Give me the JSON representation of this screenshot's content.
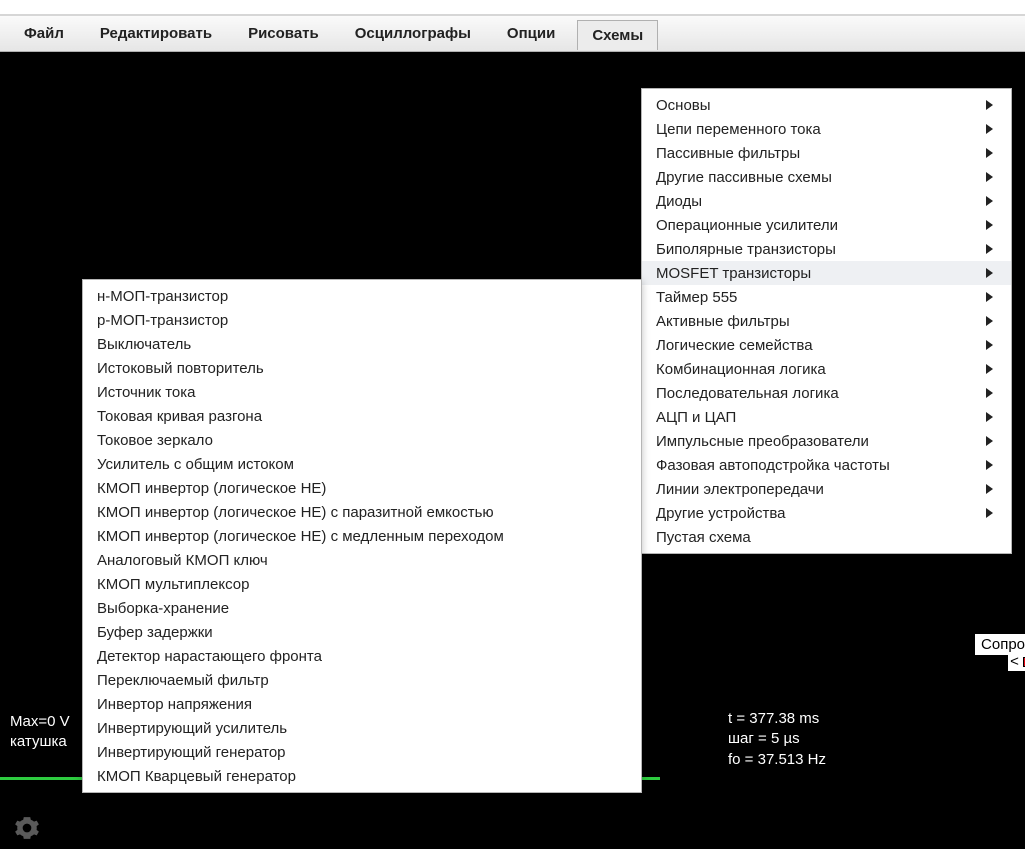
{
  "menubar": {
    "items": [
      {
        "label": "Файл"
      },
      {
        "label": "Редактировать"
      },
      {
        "label": "Рисовать"
      },
      {
        "label": "Осциллографы"
      },
      {
        "label": "Опции"
      },
      {
        "label": "Схемы",
        "active": true
      }
    ]
  },
  "main_menu": {
    "items": [
      {
        "label": "Основы",
        "submenu": true
      },
      {
        "label": "Цепи переменного тока",
        "submenu": true
      },
      {
        "label": "Пассивные фильтры",
        "submenu": true
      },
      {
        "label": "Другие пассивные схемы",
        "submenu": true
      },
      {
        "label": "Диоды",
        "submenu": true
      },
      {
        "label": "Операционные усилители",
        "submenu": true
      },
      {
        "label": "Биполярные транзисторы",
        "submenu": true
      },
      {
        "label": "MOSFET транзисторы",
        "submenu": true,
        "highlight": true
      },
      {
        "label": "Таймер 555",
        "submenu": true
      },
      {
        "label": "Активные фильтры",
        "submenu": true
      },
      {
        "label": "Логические семейства",
        "submenu": true
      },
      {
        "label": "Комбинационная логика",
        "submenu": true
      },
      {
        "label": "Последовательная логика",
        "submenu": true
      },
      {
        "label": "АЦП и ЦАП",
        "submenu": true
      },
      {
        "label": "Импульсные преобразователи",
        "submenu": true
      },
      {
        "label": "Фазовая автоподстройка частоты",
        "submenu": true
      },
      {
        "label": "Линии электропередачи",
        "submenu": true
      },
      {
        "label": "Другие устройства",
        "submenu": true
      },
      {
        "label": "Пустая схема",
        "submenu": false
      }
    ]
  },
  "sub_menu": {
    "items": [
      {
        "label": "н-МОП-транзистор"
      },
      {
        "label": "p-МОП-транзистор"
      },
      {
        "label": "Выключатель"
      },
      {
        "label": "Истоковый повторитель"
      },
      {
        "label": "Источник тока"
      },
      {
        "label": "Токовая кривая разгона"
      },
      {
        "label": "Токовое зеркало"
      },
      {
        "label": "Усилитель с общим истоком"
      },
      {
        "label": "КМОП инвертор (логическое НЕ)"
      },
      {
        "label": "КМОП инвертор (логическое НЕ) с паразитной емкостью"
      },
      {
        "label": "КМОП инвертор (логическое НЕ) с медленным переходом"
      },
      {
        "label": "Аналоговый КМОП ключ"
      },
      {
        "label": "КМОП мультиплексор"
      },
      {
        "label": "Выборка-хранение"
      },
      {
        "label": "Буфер задержки"
      },
      {
        "label": "Детектор нарастающего фронта"
      },
      {
        "label": "Переключаемый фильтр"
      },
      {
        "label": "Инвертор напряжения"
      },
      {
        "label": "Инвертирующий усилитель"
      },
      {
        "label": "Инвертирующий генератор"
      },
      {
        "label": "КМОП Кварцевый генератор"
      }
    ]
  },
  "status": {
    "left_line1": "Max=0 V",
    "left_line2": "катушка",
    "right_line1": "t = 377.38 ms",
    "right_line2": "шаг = 5 µs",
    "right_line3": "fo = 37.513 Hz"
  },
  "side": {
    "label_fragment": "Сопро",
    "arrow_glyph": "<"
  },
  "icons": {
    "gear": "gear-icon",
    "submenu_arrow": "submenu-arrow-icon"
  }
}
